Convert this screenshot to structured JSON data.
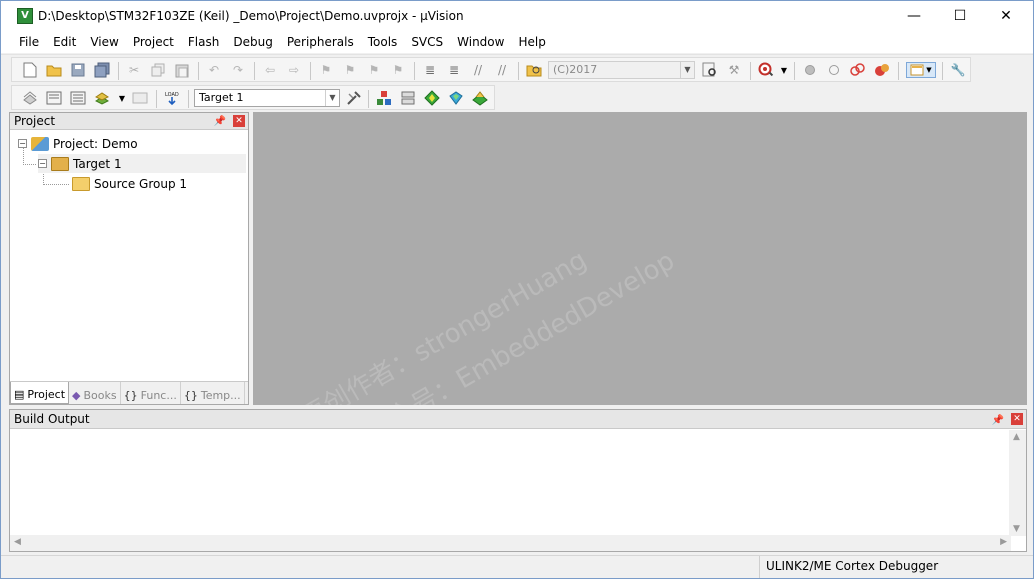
{
  "window": {
    "title": "D:\\Desktop\\STM32F103ZE  (Keil)  _Demo\\Project\\Demo.uvprojx - µVision",
    "minimize_glyph": "—",
    "maximize_glyph": "☐",
    "close_glyph": "✕"
  },
  "menu": {
    "items": [
      "File",
      "Edit",
      "View",
      "Project",
      "Flash",
      "Debug",
      "Peripherals",
      "Tools",
      "SVCS",
      "Window",
      "Help"
    ]
  },
  "toolbar1": {
    "find_combo_value": "(C)2017"
  },
  "toolbar2": {
    "target_select_value": "Target 1"
  },
  "project_pane": {
    "title": "Project",
    "tree": [
      {
        "label": "Project: Demo",
        "toggle": "−"
      },
      {
        "label": "Target 1",
        "toggle": "−"
      },
      {
        "label": "Source Group 1"
      }
    ],
    "tabs": [
      {
        "label": "Project",
        "glyph": "▤"
      },
      {
        "label": "Books",
        "glyph": "◆"
      },
      {
        "label": "Func...",
        "glyph": "{}"
      },
      {
        "label": "Temp...",
        "glyph": "{}"
      }
    ]
  },
  "build_output": {
    "title": "Build Output"
  },
  "status": {
    "debugger": "ULINK2/ME Cortex Debugger"
  },
  "watermark": {
    "line1": "原创作者：strongerHuang",
    "line2": "微信公众号：EmbeddedDevelop"
  }
}
